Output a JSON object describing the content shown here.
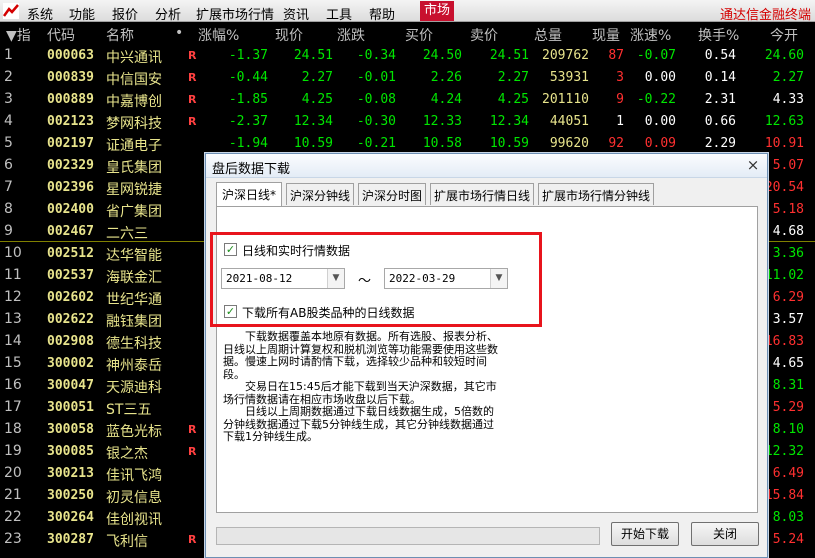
{
  "menubar": {
    "items": [
      "系统",
      "功能",
      "报价",
      "分析",
      "扩展市场行情",
      "资讯",
      "工具",
      "帮助"
    ],
    "market_label": "市场",
    "brand": "通达信金融终端"
  },
  "columns": {
    "index": "▼指",
    "code": "代码",
    "name": "名称",
    "dot": "•",
    "change_pct": "涨幅%",
    "price": "现价",
    "change": "涨跌",
    "bid": "买价",
    "ask": "卖价",
    "volume": "总量",
    "cur_vol": "现量",
    "speed": "涨速%",
    "turnover": "换手%",
    "open": "今开"
  },
  "rows": [
    {
      "i": "1",
      "code": "000063",
      "name": "中兴通讯",
      "flag": "R",
      "pct": "-1.37",
      "price": "24.51",
      "chg": "-0.34",
      "bid": "24.50",
      "ask": "24.51",
      "vol": "209762",
      "cur": "87",
      "spd": "-0.07",
      "tov": "0.54",
      "open": "24.60",
      "oc": "green"
    },
    {
      "i": "2",
      "code": "000839",
      "name": "中信国安",
      "flag": "R",
      "pct": "-0.44",
      "price": "2.27",
      "chg": "-0.01",
      "bid": "2.26",
      "ask": "2.27",
      "vol": "53931",
      "cur": "3",
      "spd": "0.00",
      "tov": "0.14",
      "open": "2.27",
      "oc": "green"
    },
    {
      "i": "3",
      "code": "000889",
      "name": "中嘉博创",
      "flag": "R",
      "pct": "-1.85",
      "price": "4.25",
      "chg": "-0.08",
      "bid": "4.24",
      "ask": "4.25",
      "vol": "201110",
      "cur": "9",
      "spd": "-0.22",
      "tov": "2.31",
      "open": "4.33",
      "oc": "white"
    },
    {
      "i": "4",
      "code": "002123",
      "name": "梦网科技",
      "flag": "R",
      "pct": "-2.37",
      "price": "12.34",
      "chg": "-0.30",
      "bid": "12.33",
      "ask": "12.34",
      "vol": "44051",
      "cur": "1",
      "spd": "0.00",
      "tov": "0.66",
      "open": "12.63",
      "oc": "green"
    },
    {
      "i": "5",
      "code": "002197",
      "name": "证通电子",
      "flag": "",
      "pct": "-1.94",
      "price": "10.59",
      "chg": "-0.21",
      "bid": "10.58",
      "ask": "10.59",
      "vol": "99620",
      "cur": "92",
      "spd": "0.09",
      "tov": "2.29",
      "open": "10.91",
      "oc": "red"
    },
    {
      "i": "6",
      "code": "002329",
      "name": "皇氏集团",
      "flag": "",
      "open": "5.07",
      "oc": "red"
    },
    {
      "i": "7",
      "code": "002396",
      "name": "星网锐捷",
      "flag": "",
      "open": "20.54",
      "oc": "red"
    },
    {
      "i": "8",
      "code": "002400",
      "name": "省广集团",
      "flag": "",
      "open": "5.18",
      "oc": "red"
    },
    {
      "i": "9",
      "code": "002467",
      "name": "二六三",
      "flag": "",
      "open": "4.68",
      "oc": "white"
    },
    {
      "i": "10",
      "code": "002512",
      "name": "达华智能",
      "flag": "",
      "open": "3.36",
      "oc": "green"
    },
    {
      "i": "11",
      "code": "002537",
      "name": "海联金汇",
      "flag": "",
      "open": "11.02",
      "oc": "green"
    },
    {
      "i": "12",
      "code": "002602",
      "name": "世纪华通",
      "flag": "",
      "open": "6.29",
      "oc": "red"
    },
    {
      "i": "13",
      "code": "002622",
      "name": "融钰集团",
      "flag": "",
      "open": "3.57",
      "oc": "white"
    },
    {
      "i": "14",
      "code": "002908",
      "name": "德生科技",
      "flag": "",
      "open": "16.83",
      "oc": "red"
    },
    {
      "i": "15",
      "code": "300002",
      "name": "神州泰岳",
      "flag": "",
      "open": "4.65",
      "oc": "white"
    },
    {
      "i": "16",
      "code": "300047",
      "name": "天源迪科",
      "flag": "",
      "open": "8.31",
      "oc": "green"
    },
    {
      "i": "17",
      "code": "300051",
      "name": "ST三五",
      "flag": "",
      "open": "5.29",
      "oc": "red"
    },
    {
      "i": "18",
      "code": "300058",
      "name": "蓝色光标",
      "flag": "R",
      "open": "8.10",
      "oc": "green"
    },
    {
      "i": "19",
      "code": "300085",
      "name": "银之杰",
      "flag": "R",
      "open": "12.32",
      "oc": "green"
    },
    {
      "i": "20",
      "code": "300213",
      "name": "佳讯飞鸿",
      "flag": "",
      "open": "6.49",
      "oc": "red"
    },
    {
      "i": "21",
      "code": "300250",
      "name": "初灵信息",
      "flag": "",
      "open": "15.84",
      "oc": "red"
    },
    {
      "i": "22",
      "code": "300264",
      "name": "佳创视讯",
      "flag": "",
      "open": "8.03",
      "oc": "green"
    },
    {
      "i": "23",
      "code": "300287",
      "name": "飞利信",
      "flag": "R",
      "open": "5.24",
      "oc": "red"
    }
  ],
  "dialog": {
    "title": "盘后数据下载",
    "close": "×",
    "tabs": [
      "沪深日线*",
      "沪深分钟线",
      "沪深分时图",
      "扩展市场行情日线",
      "扩展市场行情分钟线"
    ],
    "chk_daily": "日线和实时行情数据",
    "date_from": "2021-08-12",
    "tilde": "～",
    "date_to": "2022-03-29",
    "chk_all": "下载所有AB股类品种的日线数据",
    "notes": [
      "　　下载数据覆盖本地原有数据。所有选股、报表分析、日线以上周期计算复权和脱机浏览等功能需要使用这些数据。慢速上网时请酌情下载，选择较少品种和较短时间段。",
      "　　交易日在15:45后才能下载到当天沪深数据，其它市场行情数据请在相应市场收盘以后下载。",
      "　　日线以上周期数据通过下载日线数据生成，5倍数的分钟线数据通过下载5分钟线生成，其它分钟线数据通过下载1分钟线生成。"
    ],
    "start_btn": "开始下载",
    "close_btn": "关闭"
  }
}
